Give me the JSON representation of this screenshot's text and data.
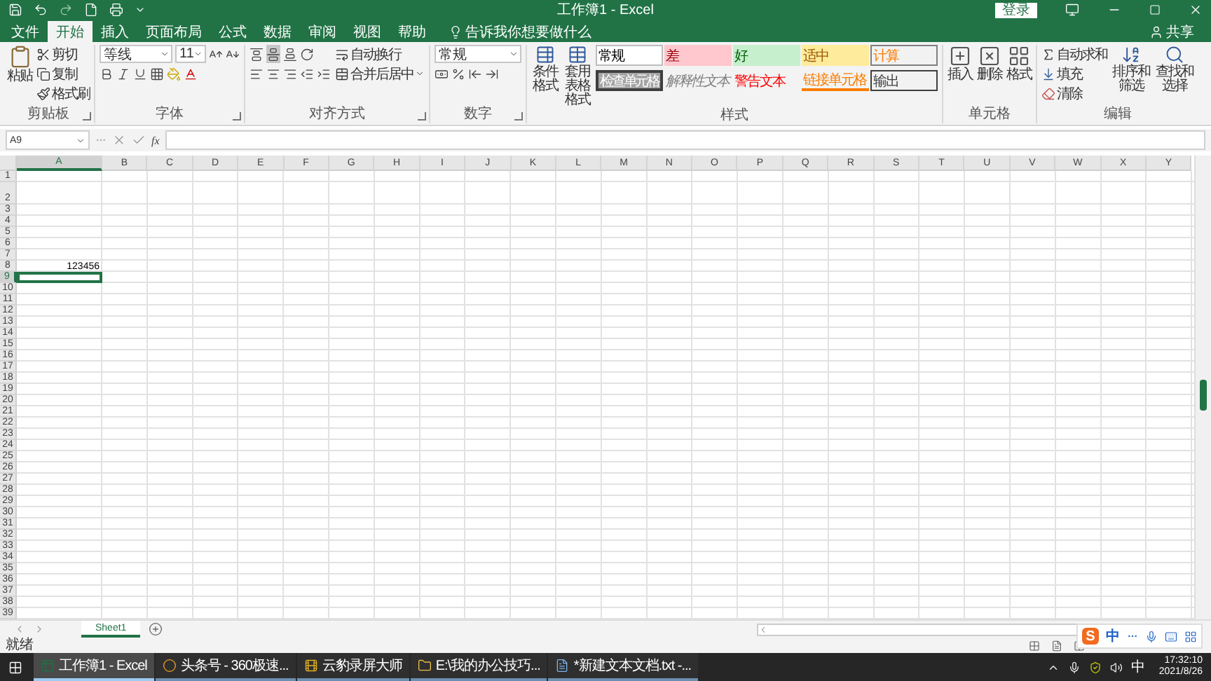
{
  "window": {
    "title": "工作簿1 - Excel",
    "login": "登录"
  },
  "tabs": [
    {
      "label": "文件",
      "selected": false
    },
    {
      "label": "开始",
      "selected": true
    },
    {
      "label": "插入",
      "selected": false
    },
    {
      "label": "页面布局",
      "selected": false
    },
    {
      "label": "公式",
      "selected": false
    },
    {
      "label": "数据",
      "selected": false
    },
    {
      "label": "审阅",
      "selected": false
    },
    {
      "label": "视图",
      "selected": false
    },
    {
      "label": "帮助",
      "selected": false
    }
  ],
  "tell_me": "告诉我你想要做什么",
  "share": "共享",
  "ribbon": {
    "clipboard": {
      "label": "剪贴板",
      "paste": "粘贴",
      "items": [
        "剪切",
        "复制",
        "格式刷"
      ]
    },
    "font": {
      "label": "字体",
      "font_name": "等线",
      "font_size": "11"
    },
    "alignment": {
      "label": "对齐方式",
      "wrap_text": "自动换行",
      "merge_center": "合并后居中"
    },
    "number": {
      "label": "数字",
      "format": "常规"
    },
    "styles": {
      "label": "样式",
      "conditional_format": "条件格式",
      "format_as_table": "套用表格格式",
      "cell_styles": [
        {
          "label": "常规",
          "kind": "plain"
        },
        {
          "label": "差",
          "kind": "bad"
        },
        {
          "label": "好",
          "kind": "good"
        },
        {
          "label": "适中",
          "kind": "neutral"
        },
        {
          "label": "计算",
          "kind": "calculation"
        },
        {
          "label": "检查单元格",
          "kind": "check"
        },
        {
          "label": "解释性文本",
          "kind": "explanatory"
        },
        {
          "label": "警告文本",
          "kind": "warning"
        },
        {
          "label": "链接单元格",
          "kind": "linked"
        },
        {
          "label": "输出",
          "kind": "output"
        }
      ]
    },
    "cells": {
      "label": "单元格",
      "items": [
        "插入",
        "删除",
        "格式"
      ]
    },
    "editing": {
      "label": "编辑",
      "small": [
        "自动求和",
        "填充",
        "清除"
      ],
      "large": [
        "排序和筛选",
        "查找和选择"
      ]
    }
  },
  "formula_bar": {
    "name_box": "A9",
    "function_label": "fx"
  },
  "sheet": {
    "columns": [
      {
        "label": "A",
        "selected": true
      },
      {
        "label": "B",
        "selected": false
      },
      {
        "label": "C",
        "selected": false
      },
      {
        "label": "D",
        "selected": false
      },
      {
        "label": "E",
        "selected": false
      },
      {
        "label": "F",
        "selected": false
      },
      {
        "label": "G",
        "selected": false
      },
      {
        "label": "H",
        "selected": false
      },
      {
        "label": "I",
        "selected": false
      },
      {
        "label": "J",
        "selected": false
      },
      {
        "label": "K",
        "selected": false
      },
      {
        "label": "L",
        "selected": false
      },
      {
        "label": "M",
        "selected": false
      },
      {
        "label": "N",
        "selected": false
      },
      {
        "label": "O",
        "selected": false
      },
      {
        "label": "P",
        "selected": false
      },
      {
        "label": "Q",
        "selected": false
      },
      {
        "label": "R",
        "selected": false
      },
      {
        "label": "S",
        "selected": false
      },
      {
        "label": "T",
        "selected": false
      },
      {
        "label": "U",
        "selected": false
      },
      {
        "label": "V",
        "selected": false
      },
      {
        "label": "W",
        "selected": false
      },
      {
        "label": "X",
        "selected": false
      },
      {
        "label": "Y",
        "selected": false
      }
    ],
    "rows": [
      {
        "label": "1",
        "selected": false,
        "tall": false
      },
      {
        "label": "2",
        "selected": false,
        "tall": true
      },
      {
        "label": "3",
        "selected": false,
        "tall": false
      },
      {
        "label": "4",
        "selected": false,
        "tall": false
      },
      {
        "label": "5",
        "selected": false,
        "tall": false
      },
      {
        "label": "6",
        "selected": false,
        "tall": false
      },
      {
        "label": "7",
        "selected": false,
        "tall": false
      },
      {
        "label": "8",
        "selected": false,
        "tall": false,
        "values": [
          "123456"
        ]
      },
      {
        "label": "9",
        "selected": true,
        "tall": false
      },
      {
        "label": "10",
        "selected": false,
        "tall": false
      },
      {
        "label": "11",
        "selected": false,
        "tall": false
      },
      {
        "label": "12",
        "selected": false,
        "tall": false
      },
      {
        "label": "13",
        "selected": false,
        "tall": false
      },
      {
        "label": "14",
        "selected": false,
        "tall": false
      },
      {
        "label": "15",
        "selected": false,
        "tall": false
      },
      {
        "label": "16",
        "selected": false,
        "tall": false
      },
      {
        "label": "17",
        "selected": false,
        "tall": false
      },
      {
        "label": "18",
        "selected": false,
        "tall": false
      },
      {
        "label": "19",
        "selected": false,
        "tall": false
      },
      {
        "label": "20",
        "selected": false,
        "tall": false
      },
      {
        "label": "21",
        "selected": false,
        "tall": false
      },
      {
        "label": "22",
        "selected": false,
        "tall": false
      },
      {
        "label": "23",
        "selected": false,
        "tall": false
      },
      {
        "label": "24",
        "selected": false,
        "tall": false
      },
      {
        "label": "25",
        "selected": false,
        "tall": false
      },
      {
        "label": "26",
        "selected": false,
        "tall": false
      },
      {
        "label": "27",
        "selected": false,
        "tall": false
      },
      {
        "label": "28",
        "selected": false,
        "tall": false
      },
      {
        "label": "29",
        "selected": false,
        "tall": false
      },
      {
        "label": "30",
        "selected": false,
        "tall": false
      },
      {
        "label": "31",
        "selected": false,
        "tall": false
      },
      {
        "label": "32",
        "selected": false,
        "tall": false
      },
      {
        "label": "33",
        "selected": false,
        "tall": false
      },
      {
        "label": "34",
        "selected": false,
        "tall": false
      },
      {
        "label": "35",
        "selected": false,
        "tall": false
      },
      {
        "label": "36",
        "selected": false,
        "tall": false
      },
      {
        "label": "37",
        "selected": false,
        "tall": false
      },
      {
        "label": "38",
        "selected": false,
        "tall": false
      },
      {
        "label": "39",
        "selected": false,
        "tall": false
      }
    ]
  },
  "sheet_tabs": [
    {
      "label": "Sheet1",
      "selected": true
    }
  ],
  "status": "就绪",
  "ime": {
    "logo": "S",
    "mode": "中"
  },
  "taskbar": {
    "items": [
      {
        "label": "工作簿1 - Excel",
        "kind": "excel",
        "active": true
      },
      {
        "label": "头条号 - 360极速...",
        "kind": "browser",
        "active": false
      },
      {
        "label": "云豹录屏大师",
        "kind": "recorder",
        "active": false
      },
      {
        "label": "E:\\我的办公技巧...",
        "kind": "folder",
        "active": false
      },
      {
        "label": "*新建文本文档.txt -...",
        "kind": "notepad",
        "active": false
      }
    ],
    "input_mode": "中",
    "time": "17:32:10",
    "date": "2021/8/26"
  }
}
